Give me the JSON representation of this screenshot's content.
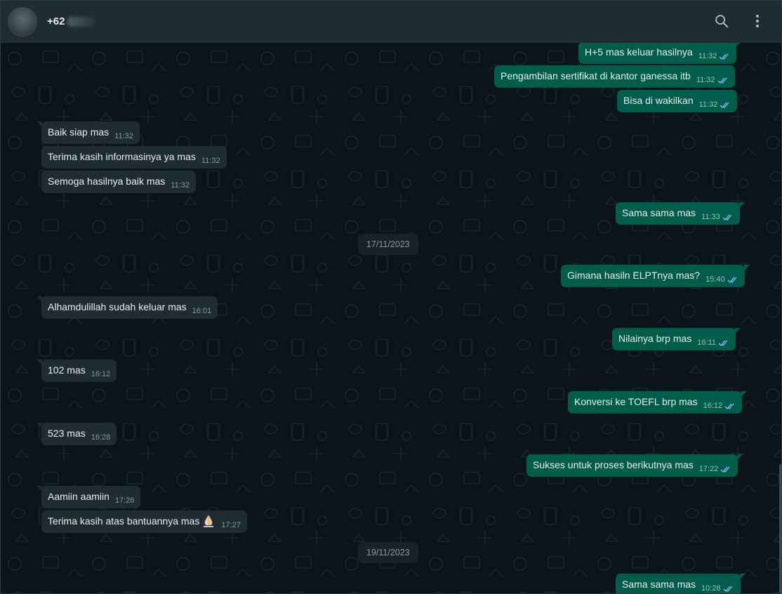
{
  "header": {
    "contact_name": "+62",
    "search_icon": "search-icon",
    "menu_icon": "kebab-menu-icon"
  },
  "colors": {
    "outgoing_bubble": "#005c4b",
    "incoming_bubble": "#202c33",
    "background": "#0b141a",
    "header": "#202c33",
    "tick_read": "#8fb7ff"
  },
  "messages": [
    {
      "dir": "out",
      "text": "H+5 mas keluar hasilnya",
      "time": "11:32"
    },
    {
      "dir": "out",
      "text": "Pengambilan sertifikat di kantor ganessa itb",
      "time": "11:32"
    },
    {
      "dir": "out",
      "text": "Bisa di wakilkan",
      "time": "11:32"
    },
    {
      "dir": "in",
      "text": "Baik siap mas",
      "time": "11:32"
    },
    {
      "dir": "in",
      "text": "Terima kasih informasinya ya mas",
      "time": "11:32"
    },
    {
      "dir": "in",
      "text": "Semoga hasilnya baik mas",
      "time": "11:32"
    },
    {
      "dir": "out",
      "text": "Sama sama mas",
      "time": "11:33"
    },
    {
      "dir": "date",
      "text": "17/11/2023"
    },
    {
      "dir": "out",
      "text": "Gimana hasiln ELPTnya mas?",
      "time": "15:40"
    },
    {
      "dir": "in",
      "text": "Alhamdulillah sudah keluar mas",
      "time": "16:01"
    },
    {
      "dir": "out",
      "text": "Nilainya brp mas",
      "time": "16:11"
    },
    {
      "dir": "in",
      "text": "102 mas",
      "time": "16:12"
    },
    {
      "dir": "out",
      "text": "Konversi ke TOEFL brp mas",
      "time": "16:12"
    },
    {
      "dir": "in",
      "text": "523 mas",
      "time": "16:28"
    },
    {
      "dir": "out",
      "text": "Sukses untuk proses berikutnya mas",
      "time": "17:22"
    },
    {
      "dir": "in",
      "text": "Aamiin aamiin",
      "time": "17:26"
    },
    {
      "dir": "in",
      "text": "Terima kasih atas bantuannya mas",
      "emoji": "folded-hands-emoji",
      "time": "17:27"
    },
    {
      "dir": "date",
      "text": "19/11/2023"
    },
    {
      "dir": "out",
      "text": "Sama sama mas",
      "time": "10:28"
    }
  ]
}
